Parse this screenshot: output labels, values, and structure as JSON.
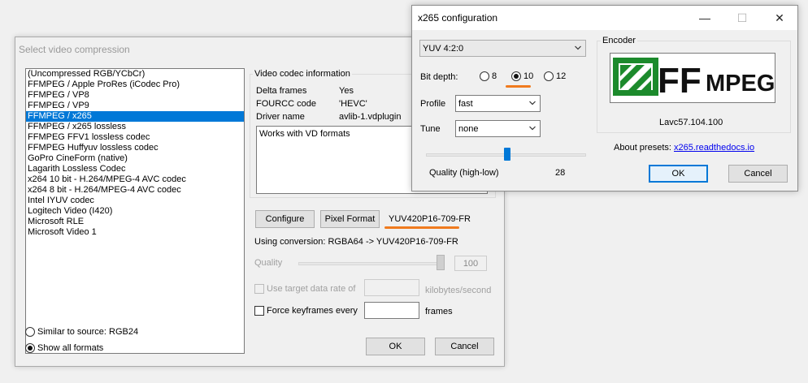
{
  "main_dialog": {
    "title": "Select video compression",
    "codecs": [
      "(Uncompressed RGB/YCbCr)",
      "FFMPEG / Apple ProRes (iCodec Pro)",
      "FFMPEG / VP8",
      "FFMPEG / VP9",
      "FFMPEG / x265",
      "FFMPEG / x265 lossless",
      "FFMPEG FFV1 lossless codec",
      "FFMPEG Huffyuv lossless codec",
      "GoPro CineForm (native)",
      "Lagarith Lossless Codec",
      "x264 10 bit - H.264/MPEG-4 AVC codec",
      "x264 8 bit - H.264/MPEG-4 AVC codec",
      "Intel IYUV codec",
      "Logitech Video (I420)",
      "Microsoft RLE",
      "Microsoft Video 1"
    ],
    "selected_codec": "FFMPEG / x265",
    "filter_similar": "Similar to source: RGB24",
    "filter_all": "Show all formats",
    "info_group_label": "Video codec information",
    "info": {
      "delta_label": "Delta frames",
      "delta_value": "Yes",
      "fourcc_label": "FOURCC code",
      "fourcc_value": "'HEVC'",
      "driver_label": "Driver name",
      "driver_value": "avlib-1.vdplugin"
    },
    "notes": "Works with VD formats",
    "configure_label": "Configure",
    "pixel_format_label": "Pixel Format",
    "pixel_format_value": "YUV420P16-709-FR",
    "conversion_text": "Using conversion: RGBA64 -> YUV420P16-709-FR",
    "quality_label": "Quality",
    "quality_value": "100",
    "quality_level": 1.0,
    "target_rate_label": "Use target data rate of",
    "target_rate_value": "",
    "target_rate_unit": "kilobytes/second",
    "keyframes_label": "Force keyframes every",
    "keyframes_value": "",
    "keyframes_unit": "frames",
    "ok_label": "OK",
    "cancel_label": "Cancel"
  },
  "x265_dialog": {
    "title": "x265 configuration",
    "window_controls": {
      "minimize": "—",
      "maximize": "☐",
      "close": "✕"
    },
    "color_format": "YUV 4:2:0",
    "bit_depth_label": "Bit depth:",
    "bit_depth_options": [
      "8",
      "10",
      "12"
    ],
    "bit_depth_selected": "10",
    "profile_label": "Profile",
    "profile_value": "fast",
    "tune_label": "Tune",
    "tune_value": "none",
    "quality_label": "Quality (high-low)",
    "quality_value": "28",
    "quality_level": 0.51,
    "encoder_group_label": "Encoder",
    "logo_text": "FFMPEG",
    "version": "Lavc57.104.100",
    "about_label": "About presets:",
    "about_link": "x265.readthedocs.io",
    "ok_label": "OK",
    "cancel_label": "Cancel"
  },
  "colors": {
    "selection": "#0078d7",
    "highlight_underline": "#f07a1e",
    "ffmpeg_green": "#1c8a2c",
    "link": "#0000ee"
  }
}
